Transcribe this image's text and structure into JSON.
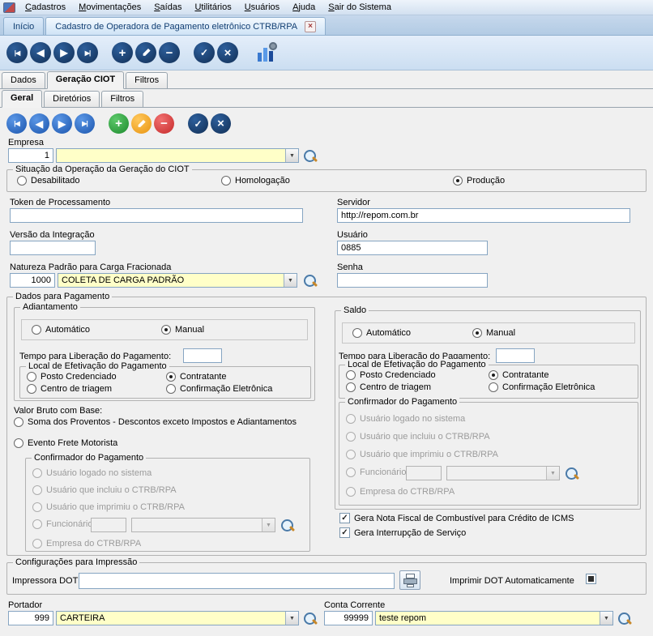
{
  "colors": {
    "chrome_blue": "#cfe0f2",
    "toolbar_icon_navy": "#17365d",
    "nav_icon_blue": "#1b55ad",
    "add_green": "#1e8a2e",
    "edit_orange": "#e8930f",
    "delete_red": "#c52a2a",
    "field_yellow": "#ffffc8",
    "tab_text_blue": "#123f73"
  },
  "icons": {
    "app": "app-logo",
    "first": "|◀",
    "prev": "◀",
    "next": "▶",
    "last": "▶|",
    "add": "+",
    "edit": "pencil",
    "remove": "−",
    "ok": "✓",
    "cancel": "×",
    "close": "×",
    "dropdown": "▼",
    "check": "✓",
    "search": "magnifier",
    "printer": "printer",
    "chart": "bar-chart-settings"
  },
  "menubar": {
    "items": [
      "Cadastros",
      "Movimentações",
      "Saídas",
      "Utilitários",
      "Usuários",
      "Ajuda",
      "Sair do Sistema"
    ]
  },
  "doc_tabs": {
    "home": "Início",
    "active_title": "Cadastro de Operadora de Pagamento eletrônico CTRB/RPA"
  },
  "main_tabs": {
    "dados": "Dados",
    "geracao_ciot": "Geração CIOT",
    "filtros": "Filtros",
    "active": "Geração CIOT"
  },
  "sub_tabs": {
    "geral": "Geral",
    "diretorios": "Diretórios",
    "filtros": "Filtros",
    "active": "Geral"
  },
  "fields": {
    "empresa": {
      "label": "Empresa",
      "code": "1",
      "name": ""
    },
    "situacao": {
      "legend": "Situação da Operação da Geração do CIOT",
      "desabilitado": "Desabilitado",
      "homologacao": "Homologação",
      "producao": "Produção",
      "selected": "Produção"
    },
    "token": {
      "label": "Token de Processamento",
      "value": ""
    },
    "servidor": {
      "label": "Servidor",
      "value": "http://repom.com.br"
    },
    "versao": {
      "label": "Versão da Integração",
      "value": ""
    },
    "usuario": {
      "label": "Usuário",
      "value": "0885"
    },
    "natureza": {
      "label": "Natureza Padrão para Carga Fracionada",
      "code": "1000",
      "name": "COLETA DE CARGA PADRÃO"
    },
    "senha": {
      "label": "Senha",
      "value": ""
    }
  },
  "pagamento": {
    "legend": "Dados para Pagamento",
    "auto_label": "Automático",
    "manual_label": "Manual",
    "tempo_label": "Tempo para Liberação do Pagamento:",
    "local_legend": "Local de Efetivação do Pagamento",
    "local_posto": "Posto Credenciado",
    "local_contratante": "Contratante",
    "local_centro": "Centro de triagem",
    "local_confirmacao": "Confirmação Eletrônica",
    "confirmador_legend": "Confirmador do Pagamento",
    "conf_logado": "Usuário logado no sistema",
    "conf_incluiu": "Usuário que incluiu o CTRB/RPA",
    "conf_imprimiu": "Usuário que imprimiu o CTRB/RPA",
    "conf_funcionario": "Funcionário:",
    "conf_empresa": "Empresa do CTRB/RPA",
    "adiantamento": {
      "legend": "Adiantamento",
      "mode_selected": "Manual",
      "tempo_value": "",
      "local_selected": "Contratante",
      "funcionario_value": ""
    },
    "saldo": {
      "legend": "Saldo",
      "mode_selected": "Manual",
      "tempo_value": "",
      "local_selected": "Contratante",
      "funcionario_value": ""
    },
    "valor_bruto": {
      "label": "Valor Bruto com Base:",
      "opt_soma": "Soma dos Proventos - Descontos exceto Impostos e Adiantamentos",
      "opt_evento": "Evento Frete Motorista",
      "selected": ""
    },
    "checks": {
      "nota_fiscal": {
        "label": "Gera Nota Fiscal de Combustível para Crédito de ICMS",
        "checked": true
      },
      "interrupcao": {
        "label": "Gera Interrupção de Serviço",
        "checked": true
      }
    }
  },
  "impressao": {
    "legend": "Configurações para Impressão",
    "impressora_label": "Impressora DOT",
    "impressora_value": "",
    "auto_label": "Imprimir DOT Automaticamente",
    "auto_checked": true
  },
  "bottom": {
    "portador": {
      "label": "Portador",
      "code": "999",
      "name": "CARTEIRA"
    },
    "conta": {
      "label": "Conta Corrente",
      "code": "99999",
      "name": "teste repom"
    }
  }
}
